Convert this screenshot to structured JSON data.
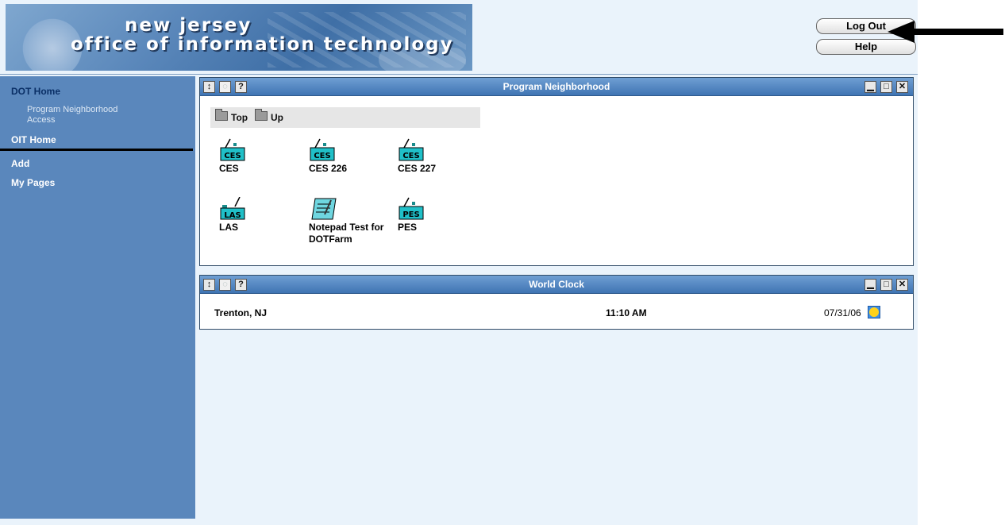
{
  "header": {
    "title_line1": "new jersey",
    "title_line2": "office of information technology",
    "logout_label": "Log Out",
    "help_label": "Help"
  },
  "sidebar": {
    "items": [
      {
        "label": "DOT Home"
      },
      {
        "label": "Program Neighborhood Access"
      },
      {
        "label": "OIT Home"
      },
      {
        "label": "Add"
      },
      {
        "label": "My Pages"
      }
    ]
  },
  "program_neighborhood": {
    "title": "Program Neighborhood",
    "crumb_top": "Top",
    "crumb_up": "Up",
    "apps": [
      {
        "label": "CES"
      },
      {
        "label": "CES 226"
      },
      {
        "label": "CES 227"
      },
      {
        "label": "LAS"
      },
      {
        "label": "Notepad Test for DOTFarm"
      },
      {
        "label": "PES"
      }
    ]
  },
  "world_clock": {
    "title": "World Clock",
    "city": "Trenton, NJ",
    "time": "11:10 AM",
    "date": "07/31/06"
  },
  "portlet_controls": {
    "help_glyph": "?"
  },
  "colors": {
    "sidebar": "#5a87bc",
    "titlebar": "#4a7dbb",
    "page_bg": "#eaf3fb"
  },
  "icons": [
    "refresh-icon",
    "edit-icon",
    "help-icon",
    "minimize-icon",
    "maximize-icon",
    "close-icon",
    "folder-icon",
    "sun-icon"
  ]
}
